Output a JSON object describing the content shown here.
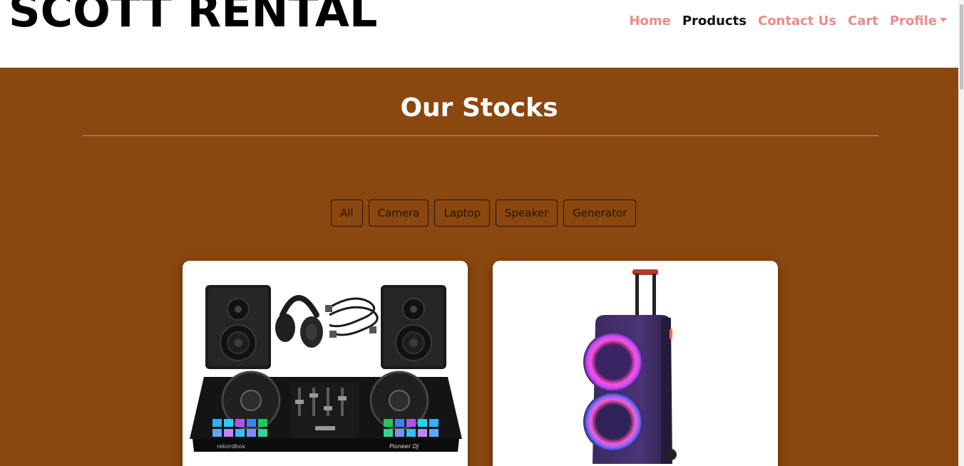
{
  "brand": "SCOTT RENTAL",
  "nav": {
    "home": "Home",
    "products": "Products",
    "contact": "Contact Us",
    "cart": "Cart",
    "profile": "Profile"
  },
  "section": {
    "title": "Our Stocks"
  },
  "filters": [
    "All",
    "Camera",
    "Laptop",
    "Speaker",
    "Generator"
  ],
  "products": [
    {
      "image": "dj-set-image",
      "brand_text": "Pioneer DJ",
      "software_text": "rekordbox"
    },
    {
      "image": "party-speaker-image"
    }
  ],
  "colors": {
    "main_bg": "#8b4710",
    "nav_link": "#ee8a8a",
    "nav_active": "#111111",
    "filter_border": "#2a1202"
  }
}
